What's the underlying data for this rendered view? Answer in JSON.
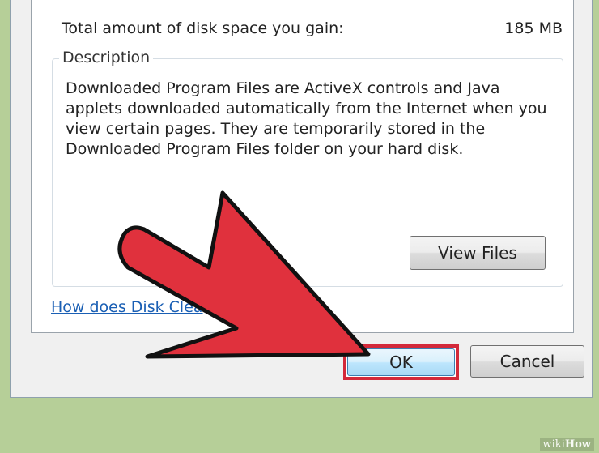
{
  "disk_gain": {
    "label": "Total amount of disk space you gain:",
    "value": "185 MB"
  },
  "description": {
    "title": "Description",
    "text": "Downloaded Program Files are ActiveX controls and Java applets downloaded automatically from the Internet when you view certain pages. They are temporarily stored in the Downloaded Program Files folder on your hard disk."
  },
  "buttons": {
    "view_files": "View Files",
    "ok": "OK",
    "cancel": "Cancel"
  },
  "help_link": "How does Disk Clea",
  "annotation": {
    "arrow_color": "#e0313d",
    "highlight_color": "#d3293a"
  },
  "watermark": {
    "prefix": "wiki",
    "suffix": "How"
  }
}
